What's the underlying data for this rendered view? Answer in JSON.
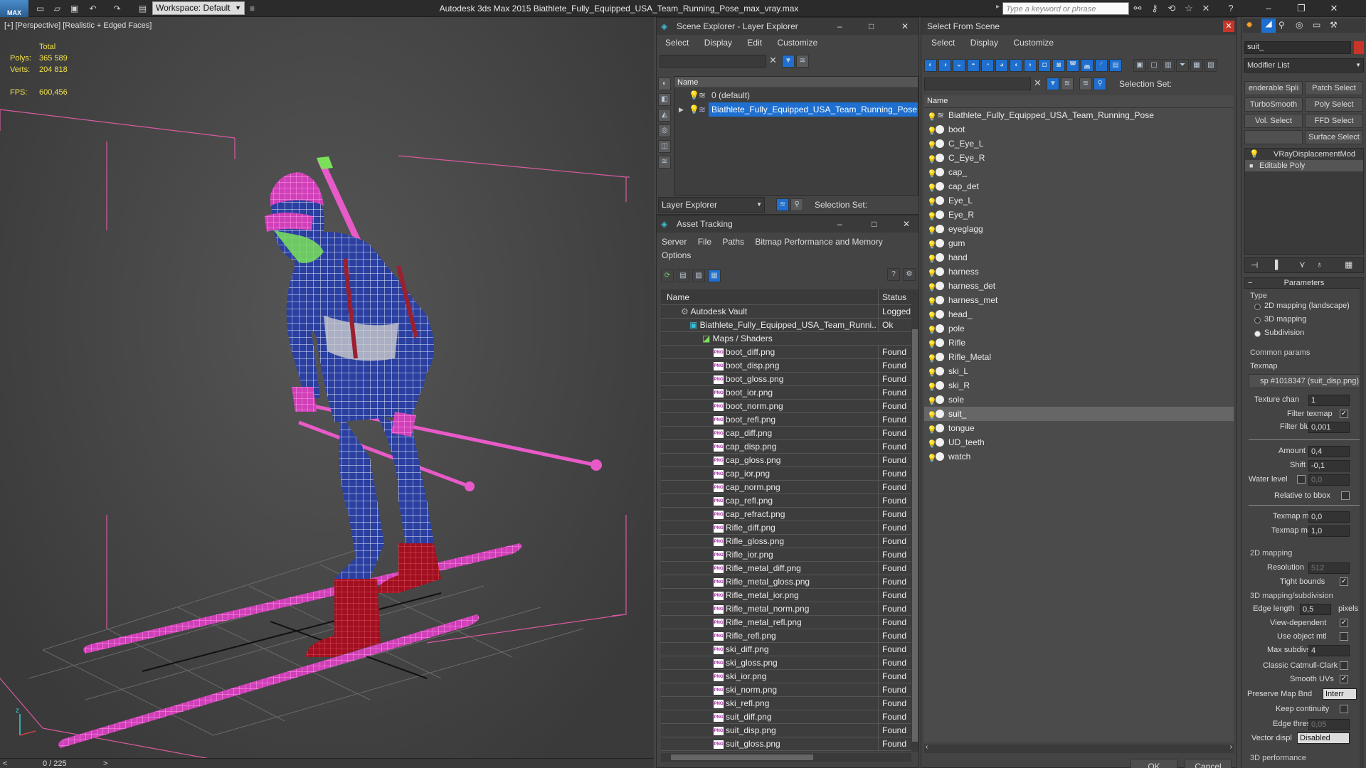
{
  "app": {
    "title": "Autodesk 3ds Max  2015    Biathlete_Fully_Equipped_USA_Team_Running_Pose_max_vray.max",
    "logo": "MAX",
    "workspace": "Workspace: Default",
    "search_placeholder": "Type a keyword or phrase"
  },
  "viewport": {
    "label": "[+] [Perspective] [Realistic + Edged Faces]",
    "stats": {
      "total_label": "Total",
      "polys_label": "Polys:",
      "polys": "365 589",
      "verts_label": "Verts:",
      "verts": "204 818",
      "fps_label": "FPS:",
      "fps": "600,456"
    },
    "timeline": "0 / 225"
  },
  "scene_explorer": {
    "title": "Scene Explorer - Layer Explorer",
    "menu": [
      "Select",
      "Display",
      "Edit",
      "Customize"
    ],
    "col_name": "Name",
    "layers": [
      "0 (default)",
      "Biathlete_Fully_Equipped_USA_Team_Running_Pose"
    ],
    "footer_label": "Layer Explorer",
    "selection_set": "Selection Set:"
  },
  "asset_tracking": {
    "title": "Asset Tracking",
    "menu": [
      "Server",
      "File",
      "Paths",
      "Bitmap Performance and Memory"
    ],
    "menu2": "Options",
    "col_name": "Name",
    "col_status": "Status",
    "vault": {
      "name": "Autodesk Vault",
      "status": "Logged"
    },
    "file": {
      "name": "Biathlete_Fully_Equipped_USA_Team_Runni...",
      "status": "Ok"
    },
    "maps": "Maps / Shaders",
    "files": [
      {
        "name": "boot_diff.png",
        "status": "Found"
      },
      {
        "name": "boot_disp.png",
        "status": "Found"
      },
      {
        "name": "boot_gloss.png",
        "status": "Found"
      },
      {
        "name": "boot_ior.png",
        "status": "Found"
      },
      {
        "name": "boot_norm.png",
        "status": "Found"
      },
      {
        "name": "boot_refl.png",
        "status": "Found"
      },
      {
        "name": "cap_diff.png",
        "status": "Found"
      },
      {
        "name": "cap_disp.png",
        "status": "Found"
      },
      {
        "name": "cap_gloss.png",
        "status": "Found"
      },
      {
        "name": "cap_ior.png",
        "status": "Found"
      },
      {
        "name": "cap_norm.png",
        "status": "Found"
      },
      {
        "name": "cap_refl.png",
        "status": "Found"
      },
      {
        "name": "cap_refract.png",
        "status": "Found"
      },
      {
        "name": "Rifle_diff.png",
        "status": "Found"
      },
      {
        "name": "Rifle_gloss.png",
        "status": "Found"
      },
      {
        "name": "Rifle_ior.png",
        "status": "Found"
      },
      {
        "name": "Rifle_metal_diff.png",
        "status": "Found"
      },
      {
        "name": "Rifle_metal_gloss.png",
        "status": "Found"
      },
      {
        "name": "Rifle_metal_ior.png",
        "status": "Found"
      },
      {
        "name": "Rifle_metal_norm.png",
        "status": "Found"
      },
      {
        "name": "Rifle_metal_refl.png",
        "status": "Found"
      },
      {
        "name": "Rifle_refl.png",
        "status": "Found"
      },
      {
        "name": "ski_diff.png",
        "status": "Found"
      },
      {
        "name": "ski_gloss.png",
        "status": "Found"
      },
      {
        "name": "ski_ior.png",
        "status": "Found"
      },
      {
        "name": "ski_norm.png",
        "status": "Found"
      },
      {
        "name": "ski_refl.png",
        "status": "Found"
      },
      {
        "name": "suit_diff.png",
        "status": "Found"
      },
      {
        "name": "suit_disp.png",
        "status": "Found"
      },
      {
        "name": "suit_gloss.png",
        "status": "Found"
      }
    ]
  },
  "select_from_scene": {
    "title": "Select From Scene",
    "menu": [
      "Select",
      "Display",
      "Customize"
    ],
    "selection_set": "Selection Set:",
    "col_name": "Name",
    "ok": "OK",
    "cancel": "Cancel",
    "objects": [
      "Biathlete_Fully_Equipped_USA_Team_Running_Pose",
      "boot",
      "C_Eye_L",
      "C_Eye_R",
      "cap_",
      "cap_det",
      "Eye_L",
      "Eye_R",
      "eyeglagg",
      "gum",
      "hand",
      "harness",
      "harness_det",
      "harness_met",
      "head_",
      "pole",
      "Rifle",
      "Rifle_Metal",
      "ski_L",
      "ski_R",
      "sole",
      "suit_",
      "tongue",
      "UD_teeth",
      "watch"
    ],
    "selected": "suit_"
  },
  "command_panel": {
    "name_field": "suit_",
    "modifier_list": "Modifier List",
    "buttons": [
      "enderable Spli",
      "Patch Select",
      "TurboSmooth",
      "Poly Select",
      "Vol. Select",
      "FFD Select",
      "",
      "Surface Select"
    ],
    "stack": [
      "VRayDisplacementMod",
      "Editable Poly"
    ],
    "params": {
      "title": "Parameters",
      "type_label": "Type",
      "types": [
        "2D mapping (landscape)",
        "3D mapping",
        "Subdivision"
      ],
      "type_selected": "Subdivision",
      "common": "Common params",
      "texmap_label": "Texmap",
      "texmap": "sp #1018347 (suit_disp.png)",
      "texture_chan_label": "Texture chan",
      "texture_chan": "1",
      "filter_texmap_label": "Filter texmap",
      "filter_blur_label": "Filter blur",
      "filter_blur": "0,001",
      "amount_label": "Amount",
      "amount": "0,4",
      "shift_label": "Shift",
      "shift": "-0,1",
      "water_label": "Water level",
      "water": "0,0",
      "relbbox_label": "Relative to bbox",
      "texmin_label": "Texmap min",
      "texmin": "0,0",
      "texmax_label": "Texmap max",
      "texmax": "1,0",
      "map2d": "2D mapping",
      "res_label": "Resolution",
      "res": "512",
      "tight_label": "Tight bounds",
      "map3d": "3D mapping/subdivision",
      "edge_label": "Edge length",
      "edge": "0,5",
      "pixels": "pixels",
      "viewdep_label": "View-dependent",
      "useobj_label": "Use object mtl",
      "maxsub_label": "Max subdivs",
      "maxsub": "4",
      "catmull_label": "Classic Catmull-Clark",
      "smooth_label": "Smooth UVs",
      "preserve_label": "Preserve Map Bnd",
      "preserve": "Interr",
      "keep_label": "Keep continuity",
      "edgethresh_label": "Edge thresh",
      "edgethresh": "0,05",
      "vecdisp_label": "Vector displ",
      "vecdisp": "Disabled",
      "perf": "3D performance"
    }
  },
  "colors": {
    "wire_blue": "#2a3fa0",
    "pink": "#e85ac8",
    "green": "#7ae05a",
    "red": "#b01020",
    "select_blue": "#1e6fd0"
  }
}
